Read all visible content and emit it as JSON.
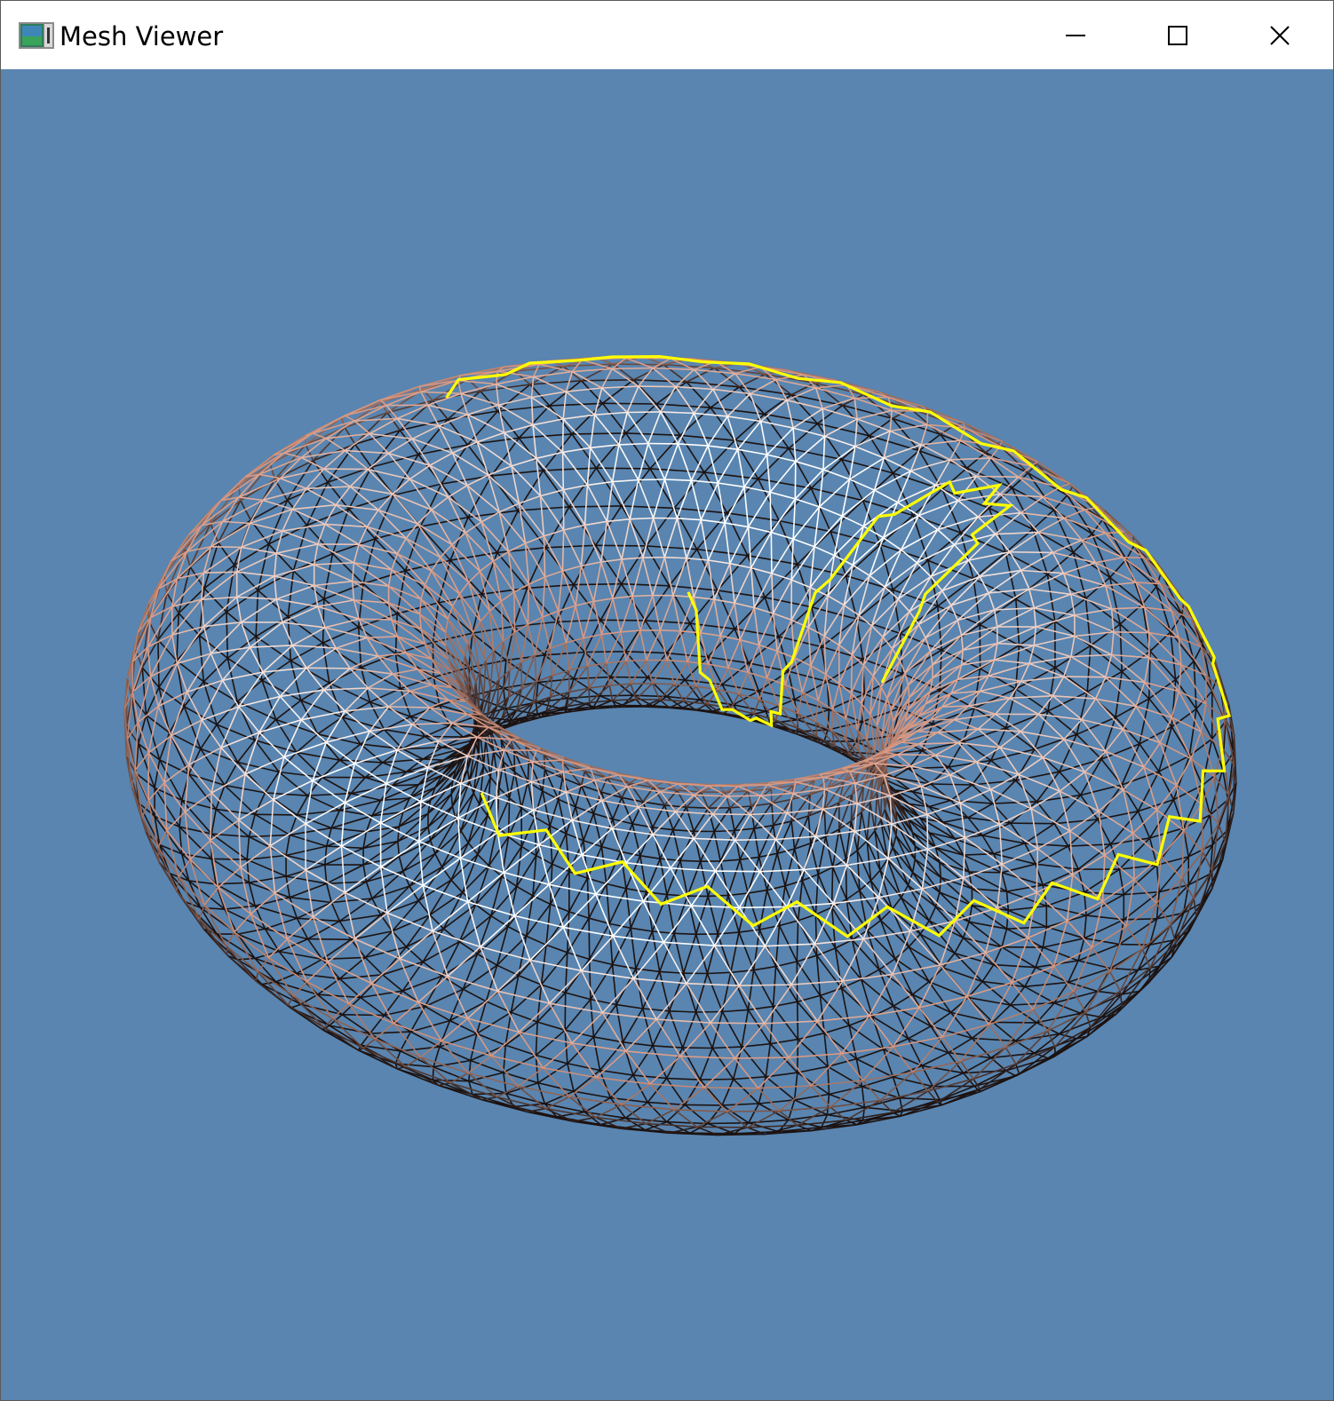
{
  "window": {
    "title": "Mesh Viewer",
    "icon": "app-icon"
  },
  "titlebar": {
    "controls": [
      {
        "name": "minimize",
        "icon": "minimize-icon"
      },
      {
        "name": "maximize",
        "icon": "maximize-icon"
      },
      {
        "name": "close",
        "icon": "close-icon"
      }
    ]
  },
  "viewport": {
    "background_color": "#5985b0",
    "mesh": {
      "shape": "torus",
      "render_mode": "wireframe",
      "edge_color_light": "#ffffff",
      "edge_color_mid": "#d89882",
      "edge_color_dark": "#1c1210"
    },
    "highlight_path": {
      "color": "#ffff00",
      "segments": 2
    }
  }
}
